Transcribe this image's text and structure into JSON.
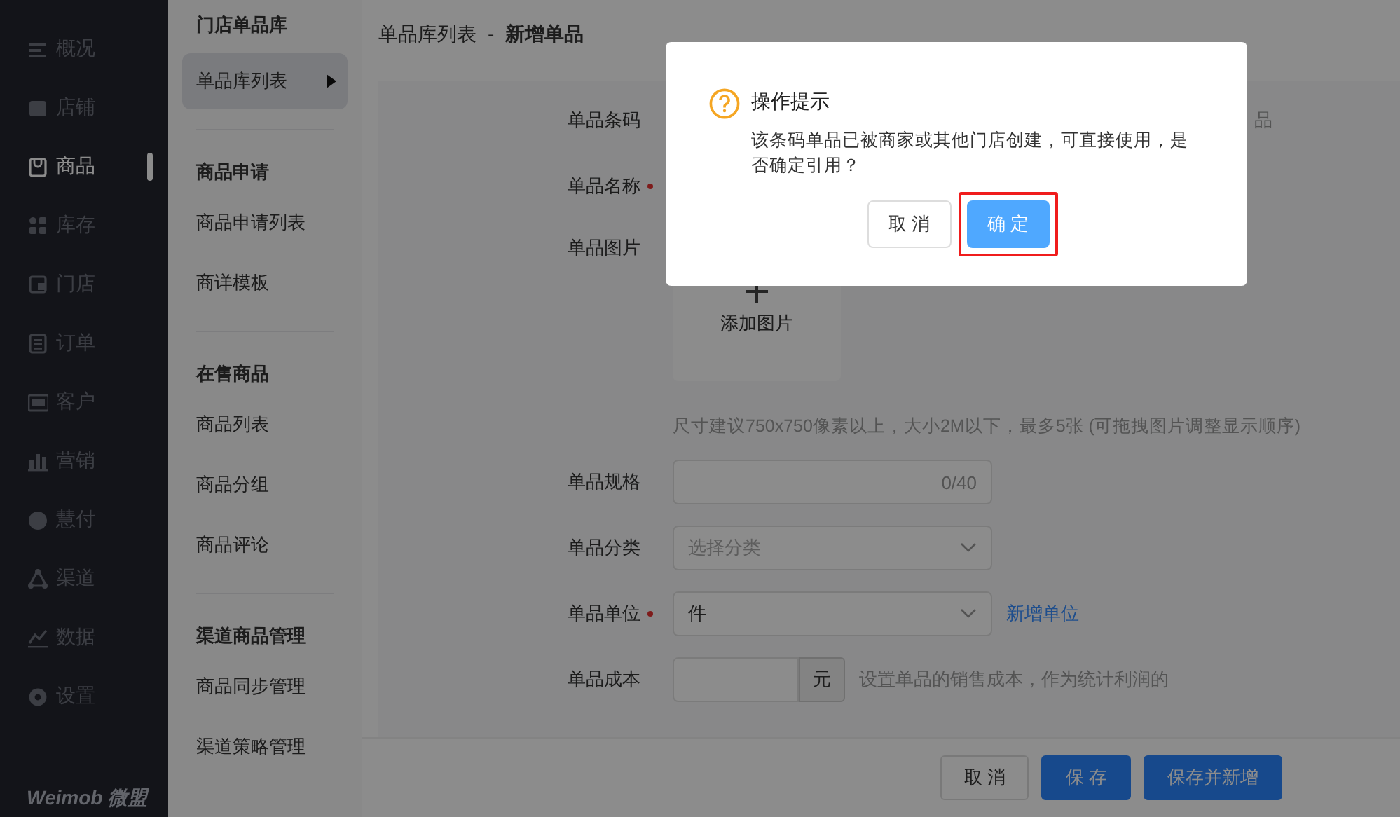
{
  "sidebar": {
    "items": [
      {
        "label": "概况",
        "selected": false
      },
      {
        "label": "店铺",
        "selected": false
      },
      {
        "label": "商品",
        "selected": true
      },
      {
        "label": "库存",
        "selected": false
      },
      {
        "label": "门店",
        "selected": false
      },
      {
        "label": "订单",
        "selected": false
      },
      {
        "label": "客户",
        "selected": false
      },
      {
        "label": "营销",
        "selected": false
      },
      {
        "label": "慧付",
        "selected": false
      },
      {
        "label": "渠道",
        "selected": false
      },
      {
        "label": "数据",
        "selected": false
      },
      {
        "label": "设置",
        "selected": false
      }
    ],
    "logo": "Weimob 微盟"
  },
  "submenu": {
    "groups": [
      {
        "title": "门店单品库",
        "items": [
          {
            "label": "单品库列表",
            "selected": true
          }
        ]
      },
      {
        "title": "商品申请",
        "items": [
          {
            "label": "商品申请列表",
            "selected": false
          },
          {
            "label": "商详模板",
            "selected": false
          }
        ]
      },
      {
        "title": "在售商品",
        "items": [
          {
            "label": "商品列表",
            "selected": false
          },
          {
            "label": "商品分组",
            "selected": false
          },
          {
            "label": "商品评论",
            "selected": false
          }
        ]
      },
      {
        "title": "渠道商品管理",
        "items": [
          {
            "label": "商品同步管理",
            "selected": false
          },
          {
            "label": "渠道策略管理",
            "selected": false
          }
        ]
      }
    ]
  },
  "breadcrumb": {
    "parent": "单品库列表",
    "separator": "-",
    "current": "新增单品"
  },
  "form": {
    "rows": [
      {
        "kind": "plain",
        "label": "单品条码",
        "required": false,
        "hint": "品"
      },
      {
        "kind": "plain",
        "label": "单品名称",
        "required": true
      },
      {
        "kind": "upload",
        "label": "单品图片",
        "required": false,
        "button_label": "添加图片",
        "hint": "尺寸建议750x750像素以上，大小2M以下，最多5张 (可拖拽图片调整显示顺序)"
      },
      {
        "kind": "counter",
        "label": "单品规格",
        "required": false,
        "counter": "0/40"
      },
      {
        "kind": "select",
        "label": "单品分类",
        "required": false,
        "placeholder": "选择分类"
      },
      {
        "kind": "select",
        "label": "单品单位",
        "required": true,
        "value": "件",
        "link": "新增单位"
      },
      {
        "kind": "addon",
        "label": "单品成本",
        "required": false,
        "unit": "元",
        "help": "设置单品的销售成本，作为统计利润的"
      }
    ]
  },
  "footer": {
    "buttons": [
      {
        "label": "取 消",
        "kind": "default"
      },
      {
        "label": "保 存",
        "kind": "primary"
      },
      {
        "label": "保存并新增",
        "kind": "primary"
      }
    ]
  },
  "dialog": {
    "title": "操作提示",
    "message": "该条码单品已被商家或其他门店创建，可直接使用，是否确定引用？",
    "buttons": [
      {
        "label": "取 消",
        "kind": "default",
        "highlighted": false
      },
      {
        "label": "确 定",
        "kind": "primary",
        "highlighted": true
      }
    ]
  }
}
